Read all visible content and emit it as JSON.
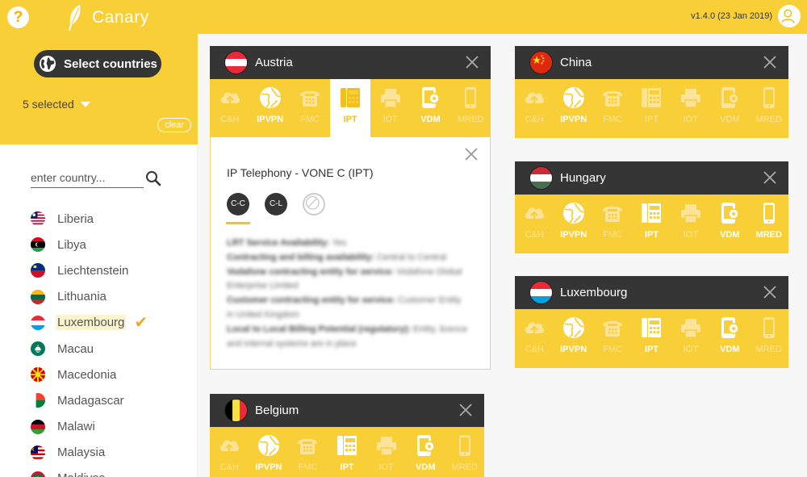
{
  "app": {
    "name": "Canary",
    "version": "v1.4.0 (23 Jan 2019)",
    "help_label": "?"
  },
  "sidebar": {
    "select_button_label": "Select countries",
    "selected_text": "5 selected",
    "clear_label": "clear",
    "search_placeholder": "enter country...",
    "countries": [
      {
        "name": "Liberia",
        "flag": "liberia"
      },
      {
        "name": "Libya",
        "flag": "libya"
      },
      {
        "name": "Liechtenstein",
        "flag": "liechtenstein"
      },
      {
        "name": "Lithuania",
        "flag": "lithuania"
      },
      {
        "name": "Luxembourg",
        "flag": "luxembourg",
        "selected": true
      },
      {
        "name": "Macau",
        "flag": "macau"
      },
      {
        "name": "Macedonia",
        "flag": "macedonia"
      },
      {
        "name": "Madagascar",
        "flag": "madagascar"
      },
      {
        "name": "Malawi",
        "flag": "malawi"
      },
      {
        "name": "Malaysia",
        "flag": "malaysia"
      },
      {
        "name": "Maldives",
        "flag": "maldives"
      }
    ]
  },
  "service_labels": [
    "C&H",
    "IPVPN",
    "FMC",
    "IPT",
    "IOT",
    "VDM",
    "MRED"
  ],
  "cards": [
    {
      "country": "Austria",
      "flag": "austria",
      "active": [
        "IPVPN",
        "IPT",
        "VDM"
      ],
      "selected": "IPT"
    },
    {
      "country": "China",
      "flag": "china",
      "active": [
        "IPVPN"
      ]
    },
    {
      "country": "Hungary",
      "flag": "hungary",
      "active": [
        "IPVPN",
        "IPT",
        "VDM",
        "MRED"
      ]
    },
    {
      "country": "Luxembourg",
      "flag": "luxembourg",
      "active": [
        "IPVPN",
        "IPT",
        "VDM"
      ]
    },
    {
      "country": "Belgium",
      "flag": "belgium",
      "active": [
        "IPVPN",
        "IPT",
        "VDM"
      ]
    }
  ],
  "detail": {
    "title": "IP Telephony - VONE C (IPT)",
    "chips": [
      "C-C",
      "C-L",
      ""
    ],
    "rows": [
      {
        "label": "LRT Service Availability:",
        "value": "Yes"
      },
      {
        "label": "Contracting and billing availability:",
        "value": "Central to Central"
      },
      {
        "label": "Vodafone contracting entity for service:",
        "value": "Vodafone Global Enterprise Limited"
      },
      {
        "label": "Customer contracting entity for service:",
        "value": "Customer Entity in United Kingdom"
      },
      {
        "label": "Local to Local Billing Potential (regulatory):",
        "value": "Entity, licence and internal systems are in place"
      }
    ]
  },
  "colors": {
    "brand_yellow": "#f9cf37",
    "dark": "#353535",
    "accent_check": "#f5a623"
  }
}
